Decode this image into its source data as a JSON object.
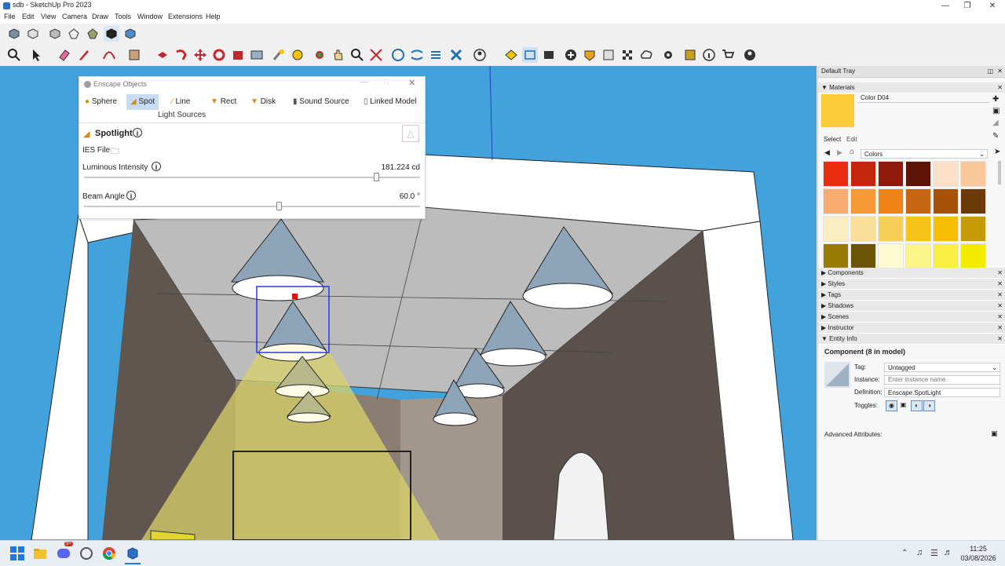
{
  "window": {
    "title": "sdb - SketchUp Pro 2023",
    "minimize_icon": "minimize-icon",
    "maximize_icon": "restore-icon",
    "close_icon": "close-icon"
  },
  "menu": [
    "File",
    "Edit",
    "View",
    "Camera",
    "Draw",
    "Tools",
    "Window",
    "Extensions",
    "Help"
  ],
  "enscape": {
    "title": "Enscape Objects",
    "tabs": [
      "Sphere",
      "Spot",
      "Line",
      "Rect",
      "Disk",
      "Sound Source",
      "Linked Model"
    ],
    "active_tab": "Spot",
    "group_label": "Light Sources",
    "heading": "Spotlight",
    "ies_label": "IES File",
    "luminous_label": "Luminous Intensity",
    "luminous_value": "181.224 cd",
    "luminous_fraction": 0.87,
    "beam_label": "Beam Angle",
    "beam_value": "60.0 °",
    "beam_fraction": 0.58
  },
  "tray": {
    "title": "Default Tray",
    "materials_label": "Materials",
    "material_name": "Color D04",
    "current_color": "#fccd3b",
    "select_tab": "Select",
    "edit_tab": "Edit",
    "library": "Colors",
    "swatches": [
      "#ea2d10",
      "#c3270b",
      "#8f1a0a",
      "#5e1307",
      "#fbdfc6",
      "#f9c79a",
      "#f8ab6e",
      "#f69a38",
      "#f08315",
      "#c66612",
      "#a65209",
      "#6b3a08",
      "#fbedc2",
      "#f9e098",
      "#f6cf57",
      "#f7c319",
      "#f6bd03",
      "#c59a07",
      "#9a7a07",
      "#6a5405",
      "#fefad0",
      "#fbf489",
      "#f9f142",
      "#f3ec00"
    ],
    "sections": [
      "Components",
      "Styles",
      "Tags",
      "Shadows",
      "Scenes",
      "Instructor",
      "Entity Info"
    ],
    "entity": {
      "title": "Component (8 in model)",
      "tag_label": "Tag:",
      "tag_value": "Untagged",
      "instance_label": "Instance:",
      "instance_placeholder": "Enter instance name",
      "definition_label": "Definition:",
      "definition_value": "Enscape.SpotLight",
      "toggles_label": "Toggles:",
      "advanced_label": "Advanced Attributes:"
    }
  },
  "taskbar": {
    "time": "11:25",
    "date": "03/08/2026",
    "badge": "9+",
    "icons": [
      "windows-start-icon",
      "file-explorer-icon",
      "discord-icon",
      "app-icon",
      "chrome-icon",
      "sketchup-icon"
    ]
  }
}
